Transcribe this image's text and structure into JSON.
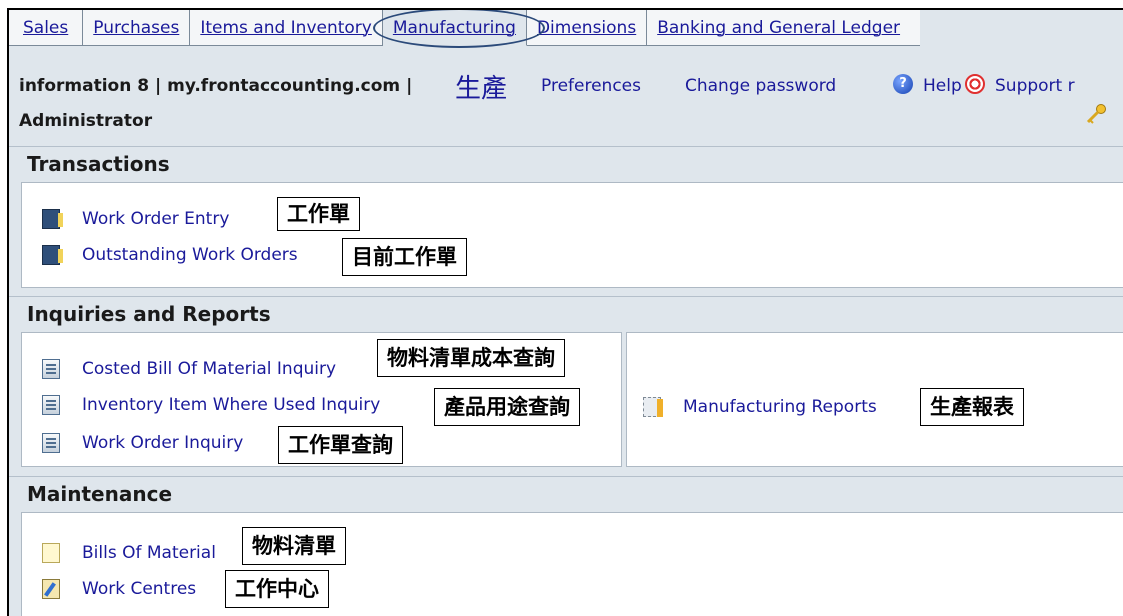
{
  "tabs": [
    {
      "label": "Sales"
    },
    {
      "label": "Purchases"
    },
    {
      "label": "Items and Inventory"
    },
    {
      "label": "Manufacturing",
      "active": true
    },
    {
      "label": "Dimensions"
    },
    {
      "label": "Banking and General Ledger"
    }
  ],
  "header": {
    "company": "information 8 | my.frontaccounting.com |",
    "user": "Administrator",
    "zh_title": "生產",
    "links": {
      "preferences": "Preferences",
      "change_password": "Change password",
      "help": "Help",
      "support": "Support r"
    },
    "icons": {
      "help": "help-icon",
      "support": "lifebuoy-icon",
      "key": "key-icon"
    }
  },
  "sections": {
    "transactions": {
      "title": "Transactions",
      "items": [
        {
          "label": "Work Order Entry",
          "note": "工作單",
          "icon": "book-icon"
        },
        {
          "label": "Outstanding Work Orders",
          "note": "目前工作單",
          "icon": "book-icon"
        }
      ]
    },
    "inquiries": {
      "title": "Inquiries and Reports",
      "items": [
        {
          "label": "Costed Bill Of Material Inquiry",
          "note": "物料清單成本查詢",
          "icon": "report-icon"
        },
        {
          "label": "Inventory Item Where Used Inquiry",
          "note": "產品用途查詢",
          "icon": "report-icon"
        },
        {
          "label": "Work Order Inquiry",
          "note": "工作單查詢",
          "icon": "report-icon"
        }
      ],
      "reports": {
        "label": "Manufacturing Reports",
        "note": "生產報表",
        "icon": "reports-icon"
      }
    },
    "maintenance": {
      "title": "Maintenance",
      "items": [
        {
          "label": "Bills Of Material",
          "note": "物料清單",
          "icon": "document-icon"
        },
        {
          "label": "Work Centres",
          "note": "工作中心",
          "icon": "edit-icon"
        }
      ]
    }
  },
  "colors": {
    "link": "#1a1a9a",
    "background": "#dfe6ec",
    "highlight_ellipse": "#2b4a7a"
  }
}
